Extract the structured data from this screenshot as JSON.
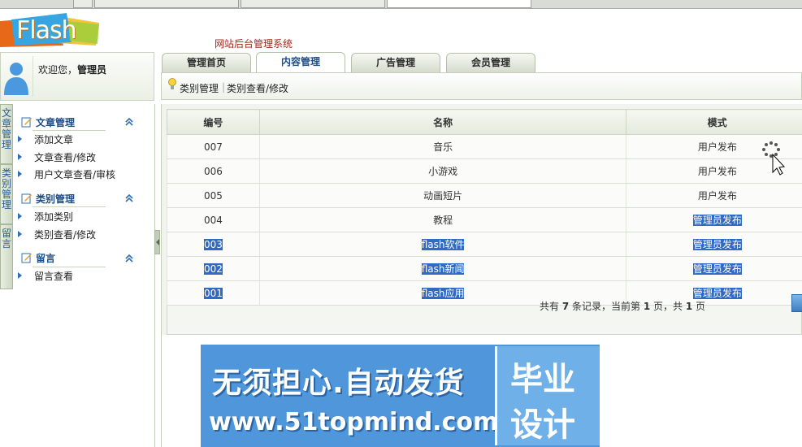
{
  "logo": {
    "text": "Flash"
  },
  "system_title": "网站后台管理系统",
  "welcome": {
    "prefix": "欢迎您，",
    "user": "管理员"
  },
  "nav_tabs": [
    {
      "label": "管理首页"
    },
    {
      "label": "内容管理",
      "active": true
    },
    {
      "label": "广告管理"
    },
    {
      "label": "会员管理"
    }
  ],
  "sub_links": [
    "类别管理",
    "类别查看/修改"
  ],
  "vertical_tabs": [
    "文章管理",
    "类别管理",
    "留言"
  ],
  "menu": {
    "sections": [
      {
        "title": "文章管理",
        "items": [
          "添加文章",
          "文章查看/修改",
          "用户文章查看/审核"
        ]
      },
      {
        "title": "类别管理",
        "items": [
          "添加类别",
          "类别查看/修改"
        ]
      },
      {
        "title": "留言",
        "items": [
          "留言查看"
        ]
      }
    ]
  },
  "table": {
    "headers": [
      "编号",
      "名称",
      "模式"
    ],
    "rows": [
      {
        "id": "007",
        "name": "音乐",
        "mode": "用户发布",
        "selected": false
      },
      {
        "id": "006",
        "name": "小游戏",
        "mode": "用户发布",
        "selected": false
      },
      {
        "id": "005",
        "name": "动画短片",
        "mode": "用户发布",
        "selected": false
      },
      {
        "id": "004",
        "name": "教程",
        "mode": "管理员发布",
        "selected": false
      },
      {
        "id": "003",
        "name": "flash软件",
        "mode": "管理员发布",
        "selected": true
      },
      {
        "id": "002",
        "name": "flash新闻",
        "mode": "管理员发布",
        "selected": true
      },
      {
        "id": "001",
        "name": "flash应用",
        "mode": "管理员发布",
        "selected": true
      }
    ]
  },
  "pager": {
    "p1": "共有 ",
    "total": "7",
    "p2": " 条记录，当前第 ",
    "current": "1",
    "p3": " 页，共 ",
    "pages": "1",
    "p4": " 页"
  },
  "banner": {
    "line1": "无须担心.自动发货",
    "line2": "www.51topmind.com",
    "box_top": "毕业",
    "box_bottom": "设计"
  },
  "colors": {
    "accent": "#1d4d86",
    "selection": "#316ac5",
    "banner_bg": "#4f97da",
    "title_red": "#a02a1c"
  }
}
